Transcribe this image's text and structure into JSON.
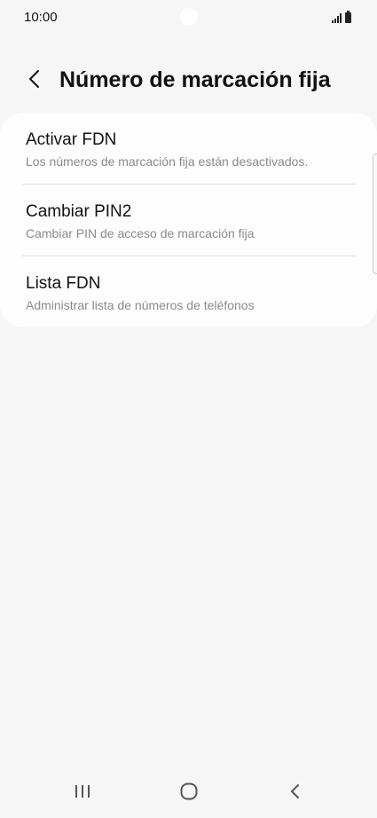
{
  "status_bar": {
    "time": "10:00"
  },
  "header": {
    "title": "Número de marcación fija"
  },
  "items": [
    {
      "title": "Activar FDN",
      "subtitle": "Los números de marcación fija están desactivados."
    },
    {
      "title": "Cambiar PIN2",
      "subtitle": "Cambiar PIN de acceso de marcación fija"
    },
    {
      "title": "Lista FDN",
      "subtitle": "Administrar lista de números de teléfonos"
    }
  ],
  "icons": {
    "back": "chevron-left-icon",
    "recents": "recent-apps-icon",
    "home": "home-icon",
    "nav_back": "nav-back-icon",
    "signal": "signal-icon",
    "battery": "battery-icon"
  },
  "colors": {
    "background": "#f6f6f6",
    "card": "#fdfdfd",
    "subtitle": "#8a8a8a"
  }
}
